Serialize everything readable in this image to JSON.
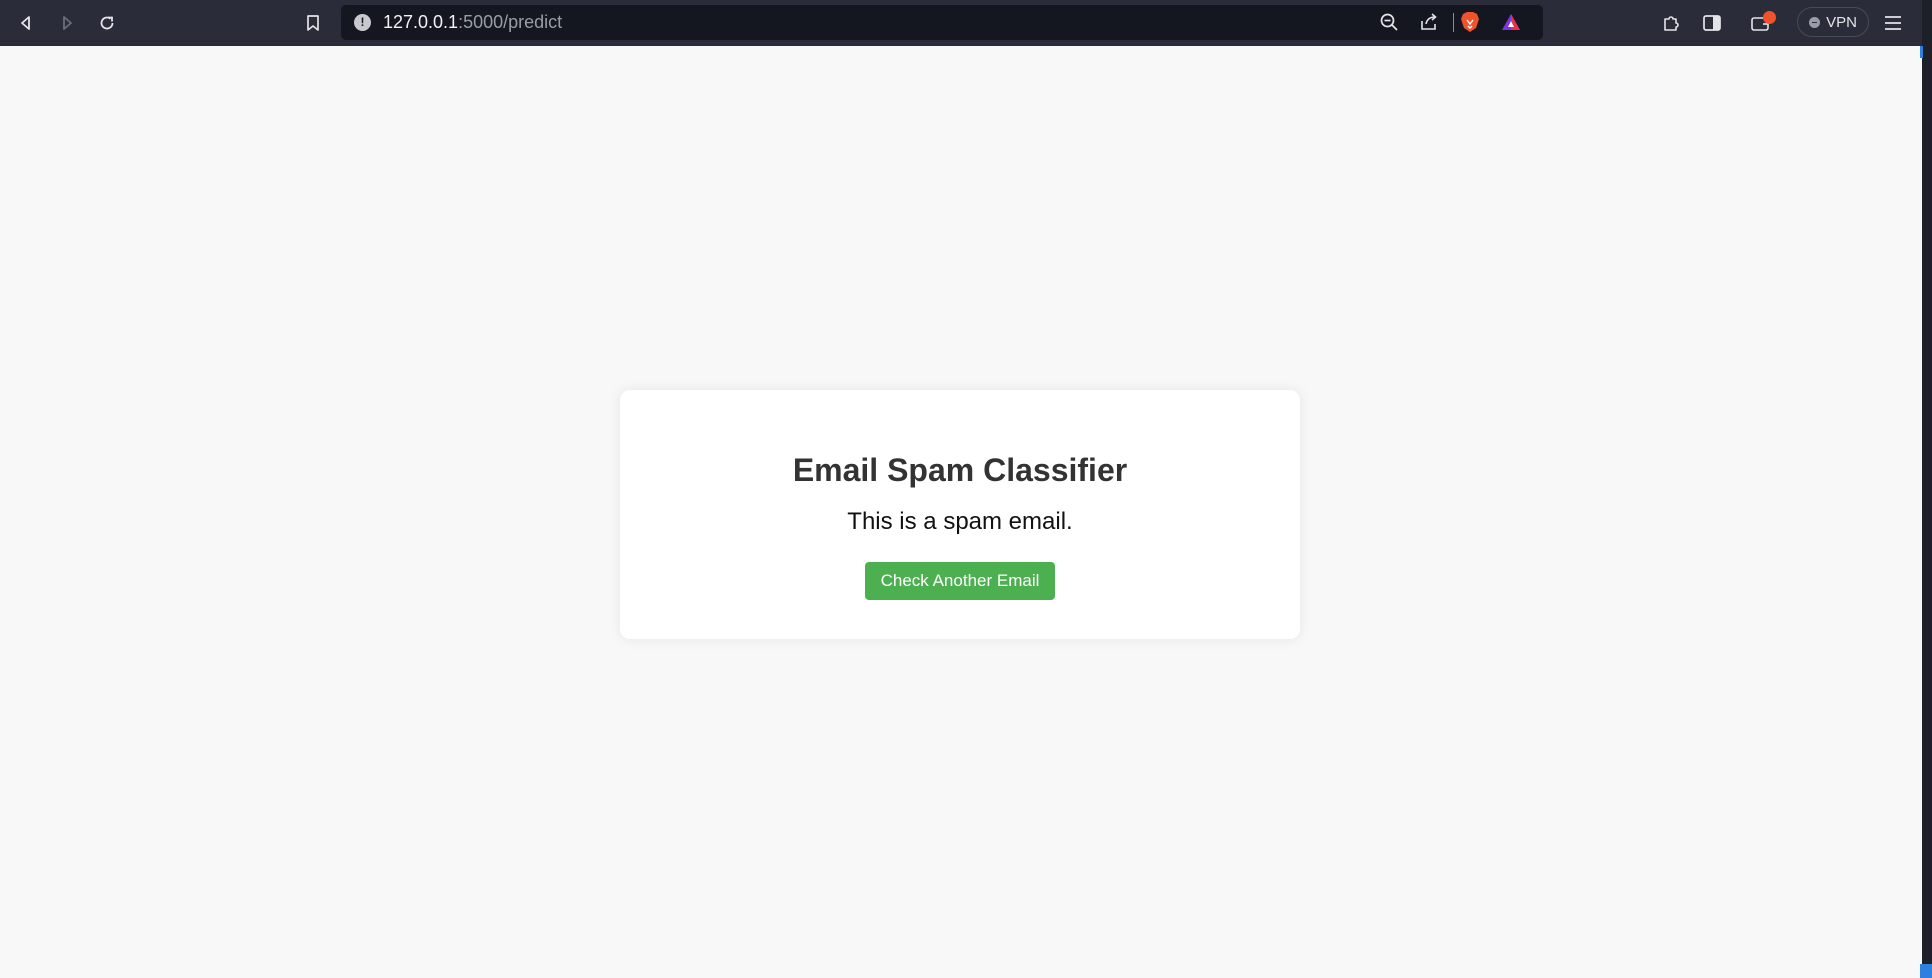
{
  "browser": {
    "url_host": "127.0.0.1",
    "url_path": ":5000/predict",
    "vpn_label": "VPN",
    "icons": {
      "back": "back-icon",
      "forward": "forward-icon",
      "reload": "reload-icon",
      "bookmark": "bookmark-icon",
      "site_info": "info-icon",
      "zoom": "zoom-out-icon",
      "share": "share-icon",
      "brave_shields": "brave-lion-icon",
      "brave_rewards": "brave-rewards-triangle-icon",
      "extensions": "puzzle-icon",
      "sidebar": "sidebar-icon",
      "wallet": "wallet-icon",
      "menu": "hamburger-menu-icon"
    },
    "colors": {
      "toolbar": "#2a2d39",
      "urlbar": "#151720",
      "badge": "#f0532b"
    }
  },
  "page": {
    "title": "Email Spam Classifier",
    "result": "This is a spam email.",
    "button_label": "Check Another Email",
    "colors": {
      "background": "#f8f8f8",
      "button": "#4caf50",
      "title": "#333333"
    }
  }
}
